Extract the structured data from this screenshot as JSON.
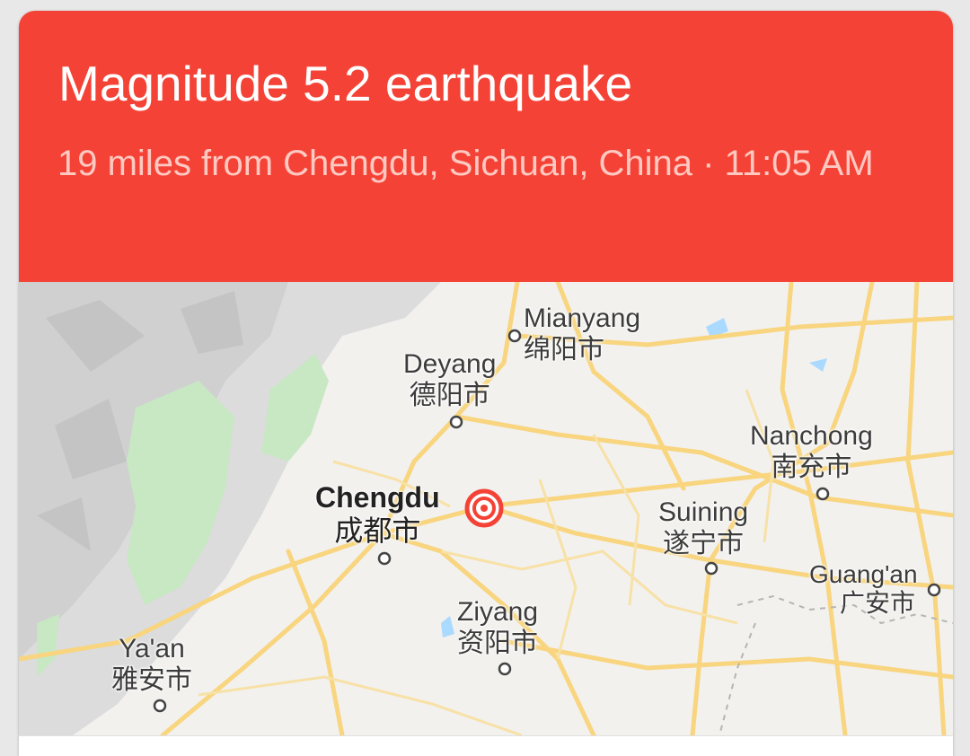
{
  "card": {
    "title": "Magnitude 5.2 earthquake",
    "subtitle": "19 miles from Chengdu, Sichuan, China · 11:05 AM",
    "header_color": "#f44336"
  },
  "map": {
    "cities": [
      {
        "en": "Mianyang",
        "zh": "绵阳市"
      },
      {
        "en": "Deyang",
        "zh": "德阳市"
      },
      {
        "en": "Nanchong",
        "zh": "南充市"
      },
      {
        "en": "Chengdu",
        "zh": "成都市"
      },
      {
        "en": "Suining",
        "zh": "遂宁市"
      },
      {
        "en": "Guang'an",
        "zh": "广安市"
      },
      {
        "en": "Ziyang",
        "zh": "资阳市"
      },
      {
        "en": "Ya'an",
        "zh": "雅安市"
      }
    ],
    "epicenter_icon": "epicenter-target-icon",
    "epicenter_color": "#f44336"
  }
}
